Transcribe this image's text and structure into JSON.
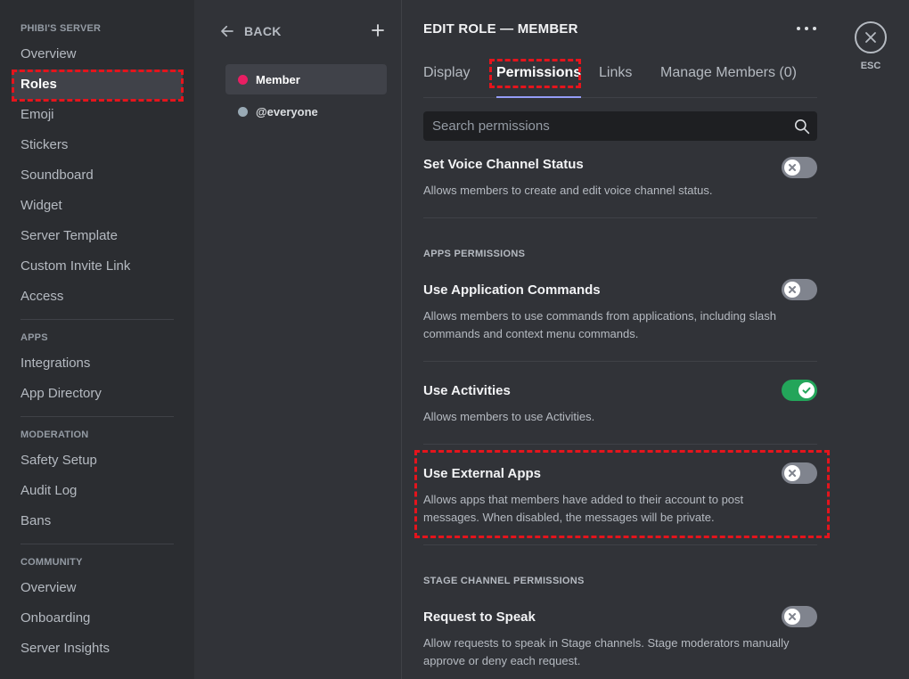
{
  "sidebar": {
    "server_header": "PHIBI'S SERVER",
    "server_items": [
      "Overview",
      "Roles",
      "Emoji",
      "Stickers",
      "Soundboard",
      "Widget",
      "Server Template",
      "Custom Invite Link",
      "Access"
    ],
    "apps_header": "APPS",
    "apps_items": [
      "Integrations",
      "App Directory"
    ],
    "moderation_header": "MODERATION",
    "moderation_items": [
      "Safety Setup",
      "Audit Log",
      "Bans"
    ],
    "community_header": "COMMUNITY",
    "community_items": [
      "Overview",
      "Onboarding",
      "Server Insights"
    ],
    "active_item": "Roles"
  },
  "roles_panel": {
    "back_label": "BACK",
    "roles": [
      {
        "name": "Member",
        "color": "#e91e63",
        "selected": true
      },
      {
        "name": "@everyone",
        "color": "#99aab5",
        "selected": false
      }
    ]
  },
  "main": {
    "title": "EDIT ROLE — MEMBER",
    "tabs": [
      "Display",
      "Permissions",
      "Links",
      "Manage Members (0)"
    ],
    "active_tab": "Permissions",
    "search_placeholder": "Search permissions",
    "permissions": [
      {
        "name": "Set Voice Channel Status",
        "desc": "Allows members to create and edit voice channel status.",
        "enabled": false
      },
      {
        "section": "APPS PERMISSIONS"
      },
      {
        "name": "Use Application Commands",
        "desc": "Allows members to use commands from applications, including slash commands and context menu commands.",
        "enabled": false
      },
      {
        "name": "Use Activities",
        "desc": "Allows members to use Activities.",
        "enabled": true
      },
      {
        "name": "Use External Apps",
        "desc": "Allows apps that members have added to their account to post messages. When disabled, the messages will be private.",
        "enabled": false
      },
      {
        "section": "STAGE CHANNEL PERMISSIONS"
      },
      {
        "name": "Request to Speak",
        "desc": "Allow requests to speak in Stage channels. Stage moderators manually approve or deny each request.",
        "enabled": false
      }
    ]
  },
  "close": {
    "esc_label": "ESC"
  },
  "colors": {
    "accent_tab": "#949cf7",
    "toggle_on": "#23a55a",
    "toggle_off": "#80848e",
    "highlight": "#e5141c"
  }
}
